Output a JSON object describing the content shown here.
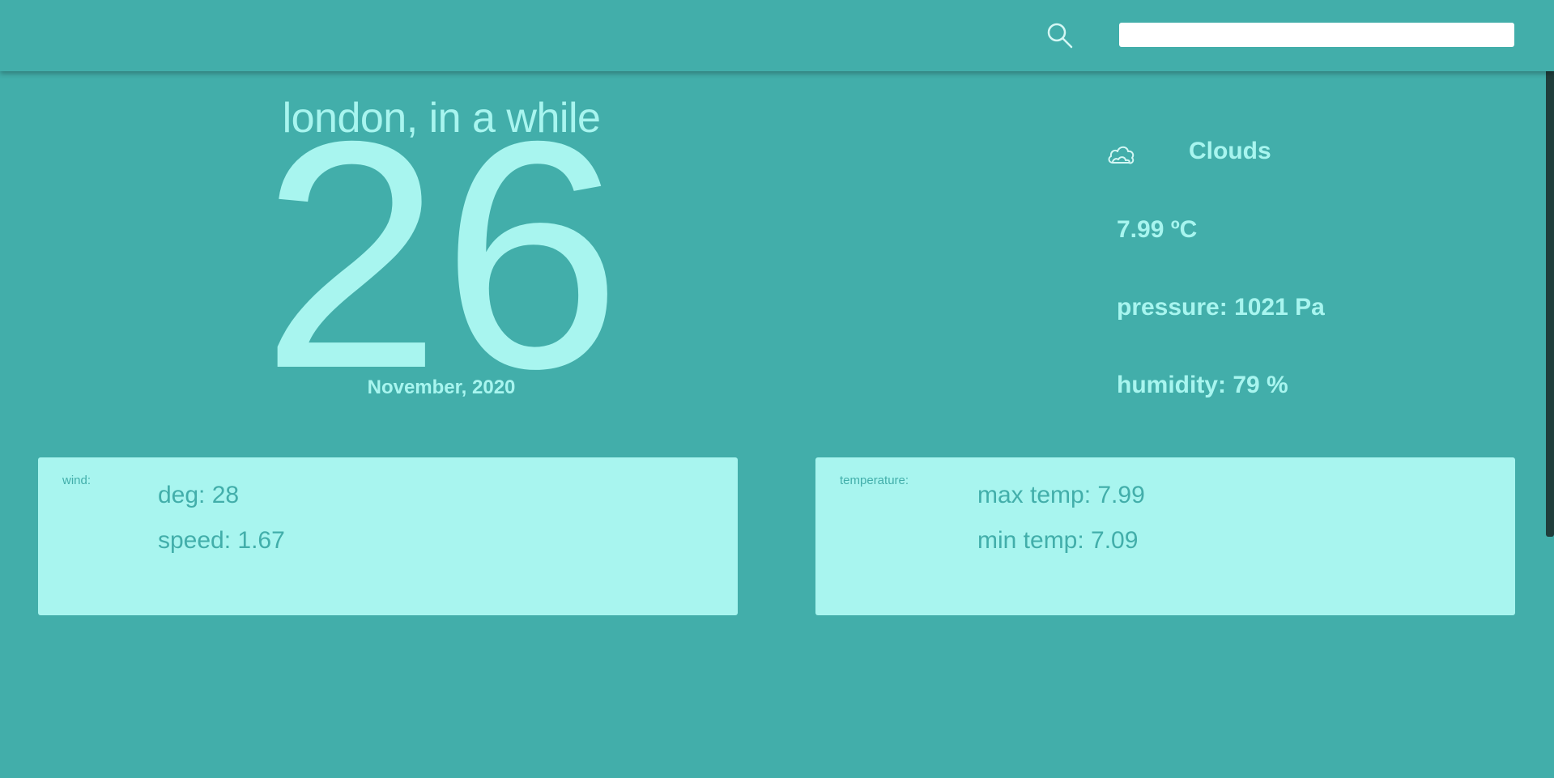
{
  "search": {
    "value": ""
  },
  "scrollbar": {
    "position": 0
  },
  "main": {
    "city": "london, in a while",
    "day": "26",
    "month_year": "November, 2020"
  },
  "conditions": {
    "icon": "cloud-icon",
    "label": "Clouds",
    "temperature": "7.99 ºC",
    "pressure": "pressure: 1021 Pa",
    "humidity": "humidity: 79 %"
  },
  "wind": {
    "label": "wind:",
    "deg": "deg: 28",
    "speed": "speed: 1.67"
  },
  "temperature": {
    "label": "temperature:",
    "max": "max temp: 7.99",
    "min": "min temp: 7.09"
  },
  "colors": {
    "background": "#42aeaa",
    "accent_light": "#a8f5ef",
    "scroll_thumb": "#1f3e3c"
  }
}
